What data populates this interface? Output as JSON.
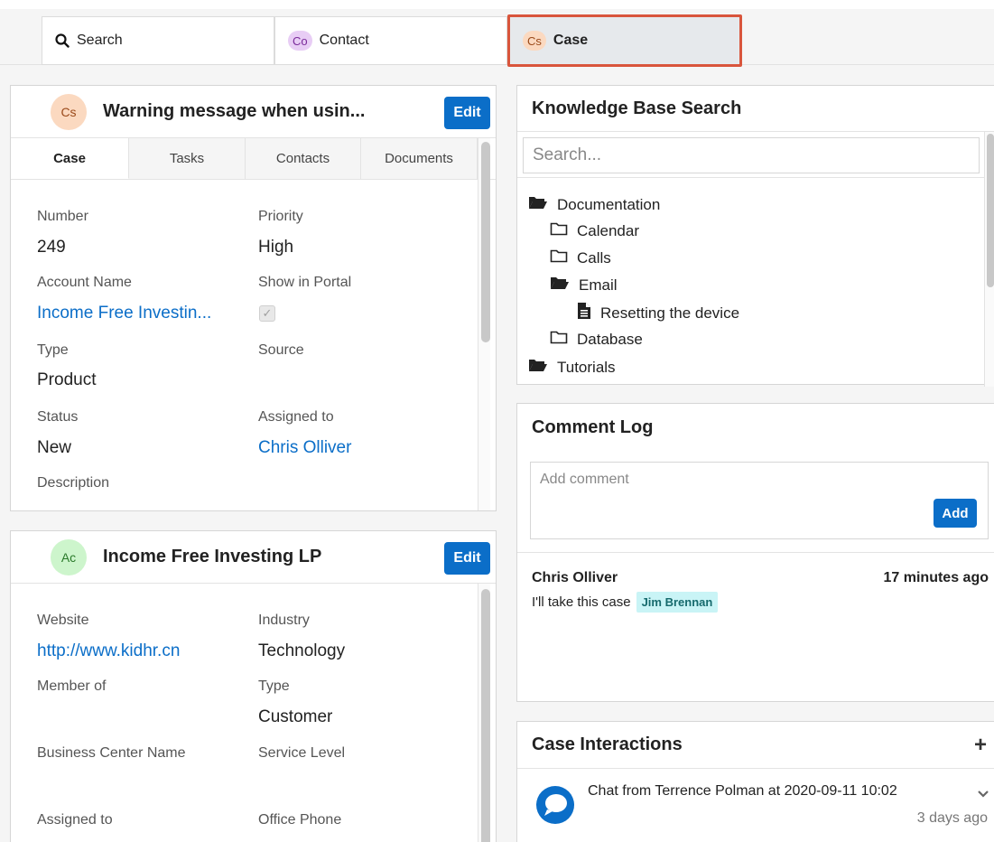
{
  "tabs": {
    "search_label": "Search",
    "contact_pill": "Co",
    "contact_label": "Contact",
    "case_pill": "Cs",
    "case_label": "Case"
  },
  "case_panel": {
    "avatar": "Cs",
    "title": "Warning message when usin...",
    "edit_label": "Edit",
    "subtabs": [
      "Case",
      "Tasks",
      "Contacts",
      "Documents"
    ],
    "fields": {
      "number_label": "Number",
      "number_value": "249",
      "priority_label": "Priority",
      "priority_value": "High",
      "account_label": "Account Name",
      "account_value": "Income Free Investin...",
      "portal_label": "Show in Portal",
      "type_label": "Type",
      "type_value": "Product",
      "source_label": "Source",
      "status_label": "Status",
      "status_value": "New",
      "assigned_label": "Assigned to",
      "assigned_value": "Chris Olliver",
      "description_label": "Description"
    }
  },
  "account_panel": {
    "avatar": "Ac",
    "title": "Income Free Investing LP",
    "edit_label": "Edit",
    "fields": {
      "website_label": "Website",
      "website_value": "http://www.kidhr.cn",
      "industry_label": "Industry",
      "industry_value": "Technology",
      "member_label": "Member of",
      "type_label": "Type",
      "type_value": "Customer",
      "business_label": "Business Center Name",
      "service_label": "Service Level",
      "assigned_label": "Assigned to",
      "phone_label": "Office Phone"
    }
  },
  "knowledge_base": {
    "title": "Knowledge Base Search",
    "search_placeholder": "Search...",
    "tree": [
      "Documentation",
      "Calendar",
      "Calls",
      "Email",
      "Resetting the device",
      "Database",
      "Tutorials"
    ]
  },
  "comment_log": {
    "title": "Comment Log",
    "placeholder": "Add comment",
    "add_label": "Add",
    "comment": {
      "author": "Chris Olliver",
      "time": "17 minutes ago",
      "text": "I'll take this case",
      "mention": "Jim Brennan"
    }
  },
  "case_interactions": {
    "title": "Case Interactions",
    "add_icon": "+",
    "item": {
      "text": "Chat from Terrence Polman at 2020-09-11 10:02",
      "time": "3 days ago"
    }
  }
}
